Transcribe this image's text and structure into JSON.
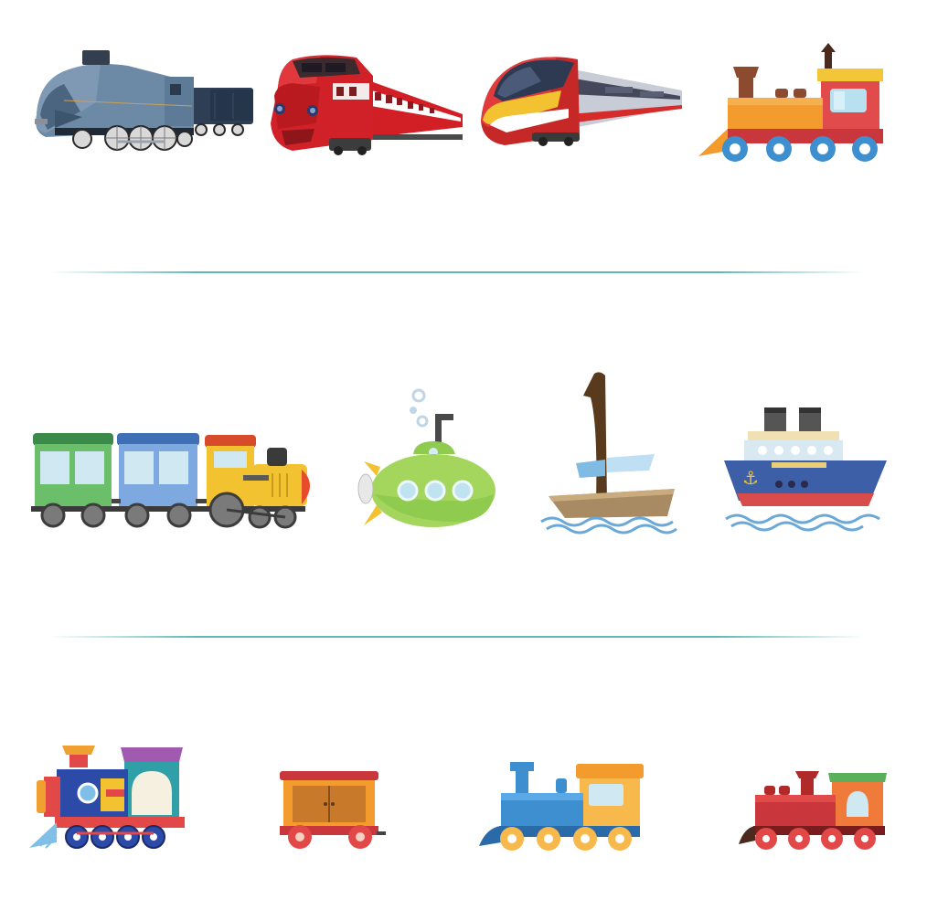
{
  "items": [
    {
      "row": 1,
      "icon": "steam-locomotive-mallard-icon"
    },
    {
      "row": 1,
      "icon": "red-diesel-train-icon"
    },
    {
      "row": 1,
      "icon": "high-speed-train-icon"
    },
    {
      "row": 1,
      "icon": "toy-locomotive-icon"
    },
    {
      "row": 2,
      "icon": "toy-train-with-wagons-icon"
    },
    {
      "row": 2,
      "icon": "submarine-icon"
    },
    {
      "row": 2,
      "icon": "sailboat-icon"
    },
    {
      "row": 2,
      "icon": "steamship-icon"
    },
    {
      "row": 3,
      "icon": "colorful-steam-locomotive-icon"
    },
    {
      "row": 3,
      "icon": "freight-wagon-icon"
    },
    {
      "row": 3,
      "icon": "blue-locomotive-icon"
    },
    {
      "row": 3,
      "icon": "red-locomotive-icon"
    }
  ],
  "colors": {
    "divider": "#5fb9b9",
    "background": "#ffffff"
  }
}
